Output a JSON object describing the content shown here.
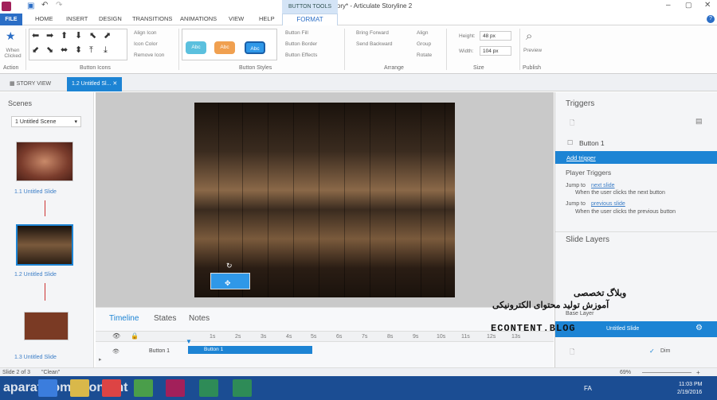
{
  "window": {
    "title": "Untitled1.story* - Articulate Storyline 2",
    "tools_header": "BUTTON TOOLS"
  },
  "tabs": {
    "file": "FILE",
    "home": "HOME",
    "insert": "INSERT",
    "design": "DESIGN",
    "transitions": "TRANSITIONS",
    "animations": "ANIMATIONS",
    "view": "VIEW",
    "help": "HELP",
    "format": "FORMAT"
  },
  "ribbon": {
    "action": {
      "label": "When Clicked",
      "group": "Action"
    },
    "icons": {
      "align_icon": "Align Icon",
      "icon_color": "Icon Color",
      "remove_icon": "Remove Icon",
      "group": "Button Icons"
    },
    "styles": {
      "abc": "Abc",
      "fill": "Button Fill",
      "border": "Button Border",
      "effects": "Button Effects",
      "group": "Button Styles"
    },
    "arrange": {
      "bring_forward": "Bring Forward",
      "send_backward": "Send Backward",
      "align": "Align",
      "group_label": "Group",
      "rotate": "Rotate",
      "group": "Arrange"
    },
    "size": {
      "height_label": "Height:",
      "height": "48 px",
      "width_label": "Width:",
      "width": "104 px",
      "group": "Size"
    },
    "publish": {
      "preview": "Preview",
      "group": "Publish"
    }
  },
  "view_tabs": {
    "story_view": "STORY VIEW",
    "slide_tab": "1.2 Untitled Sl..."
  },
  "scenes": {
    "title": "Scenes",
    "dropdown": "1 Untitled Scene",
    "slides": [
      {
        "label": "1.1 Untitled Slide"
      },
      {
        "label": "1.2 Untitled Slide"
      },
      {
        "label": "1.3 Untitled Slide"
      }
    ]
  },
  "timeline": {
    "tabs": {
      "timeline": "Timeline",
      "states": "States",
      "notes": "Notes"
    },
    "ticks": [
      "1s",
      "2s",
      "3s",
      "4s",
      "5s",
      "6s",
      "7s",
      "8s",
      "9s",
      "10s",
      "11s",
      "12s",
      "13s"
    ],
    "row_name": "Button 1",
    "bar_label": "Button 1"
  },
  "triggers": {
    "title": "Triggers",
    "object": "Button 1",
    "add_trigger": "Add trigger",
    "player_triggers": "Player Triggers",
    "t1": {
      "action": "Jump to",
      "link": "next slide",
      "condition": "When the user clicks the next button"
    },
    "t2": {
      "action": "Jump to",
      "link": "previous slide",
      "condition": "When the user clicks the previous button"
    }
  },
  "layers": {
    "title": "Slide Layers",
    "base_layer": "Base Layer",
    "layer_name": "Untitled Slide",
    "dim": "Dim"
  },
  "watermark": {
    "line1": "وبلاگ تخصصی",
    "line2": "آموزش تولید محتوای الکترونیکی",
    "brand": "ECONTENT.BLOG"
  },
  "status": {
    "slide": "Slide 2 of 3",
    "theme": "\"Clean\"",
    "zoom": "69%"
  },
  "taskbar": {
    "url_overlay": "aparat.com/econtent",
    "lang": "FA",
    "time": "11:03 PM",
    "date": "2/19/2016"
  }
}
